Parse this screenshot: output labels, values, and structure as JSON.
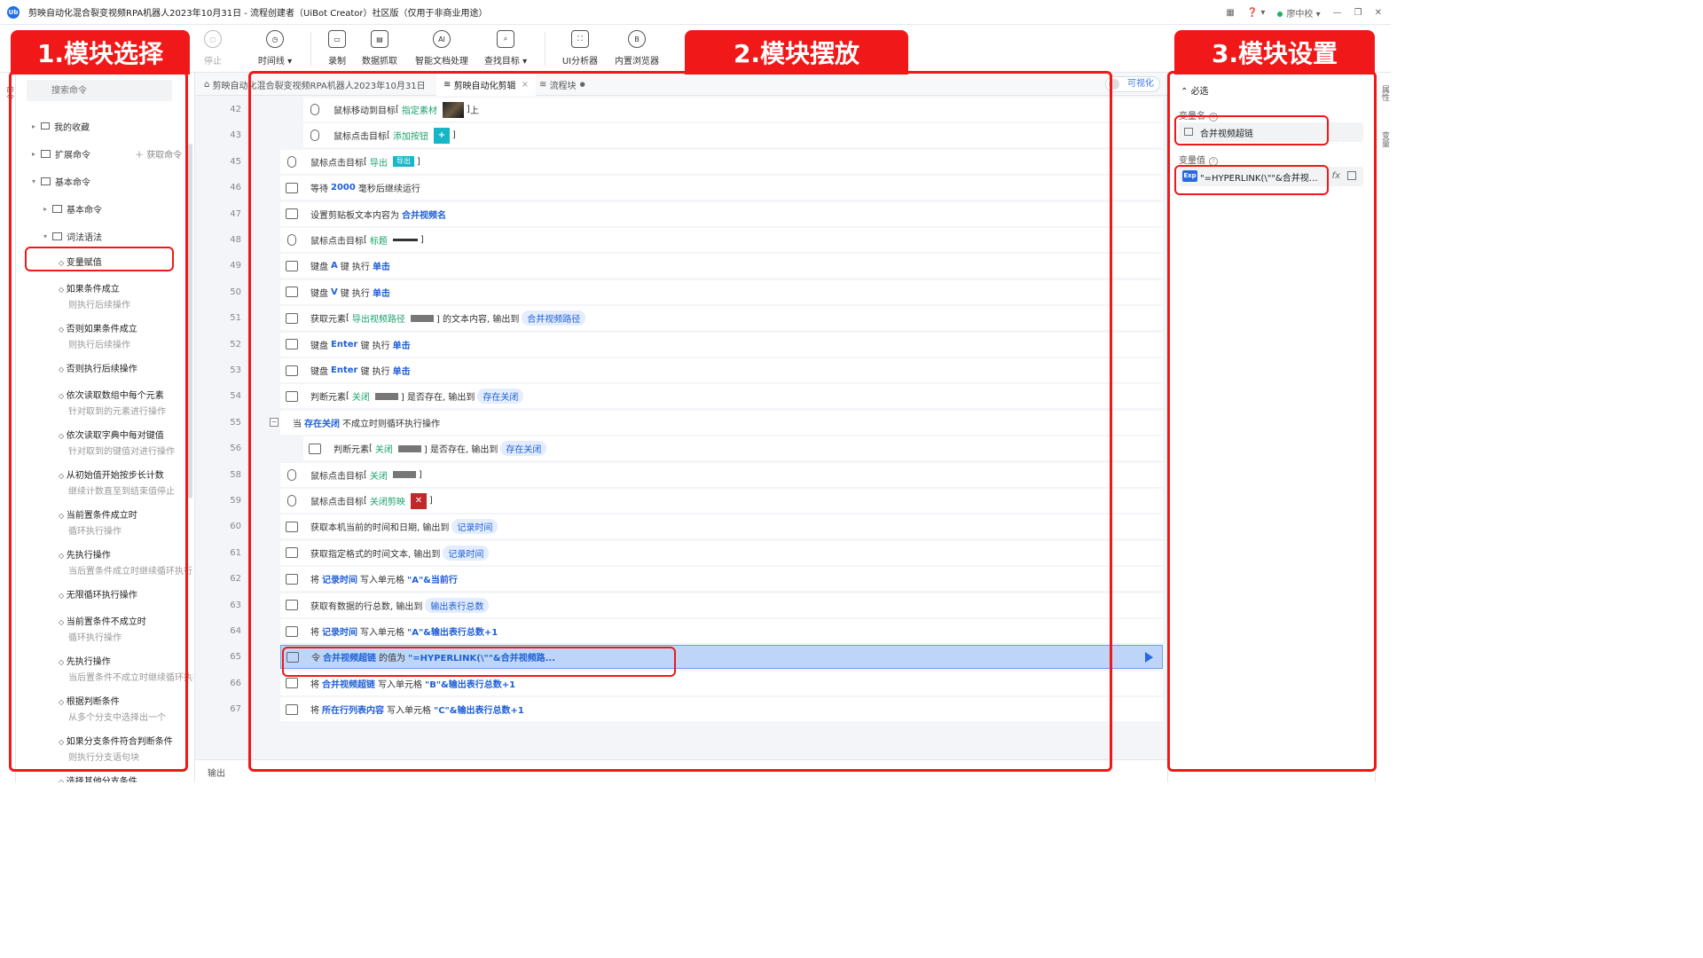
{
  "app": {
    "title": "剪映自动化混合裂变视频RPA机器人2023年10月31日 - 流程创建者（UiBot Creator）社区版（仅用于非商业用途）",
    "user": "廖中校"
  },
  "toolbar": [
    "停止",
    "时间线",
    "录制",
    "数据抓取",
    "智能文档处理",
    "查找目标",
    "UI分析器",
    "内置浏览器"
  ],
  "left_edge_label": "命令",
  "left": {
    "search_placeholder": "搜索命令",
    "fav": "我的收藏",
    "ext": "扩展命令",
    "get": "获取命令",
    "basic": "基本命令",
    "basic_sub": "基本命令",
    "syntax": "词法语法",
    "commands": [
      {
        "t": "变量赋值",
        "s": ""
      },
      {
        "t": "如果条件成立",
        "s": "则执行后续操作"
      },
      {
        "t": "否则如果条件成立",
        "s": "则执行后续操作"
      },
      {
        "t": "否则执行后续操作",
        "s": ""
      },
      {
        "t": "依次读取数组中每个元素",
        "s": "针对取到的元素进行操作"
      },
      {
        "t": "依次读取字典中每对键值",
        "s": "针对取到的键值对进行操作"
      },
      {
        "t": "从初始值开始按步长计数",
        "s": "继续计数直至到结束值停止"
      },
      {
        "t": "当前置条件成立时",
        "s": "循环执行操作"
      },
      {
        "t": "先执行操作",
        "s": "当后置条件成立时继续循环执行"
      },
      {
        "t": "无限循环执行操作",
        "s": ""
      },
      {
        "t": "当前置条件不成立时",
        "s": "循环执行操作"
      },
      {
        "t": "先执行操作",
        "s": "当后置条件不成立时继续循环执行"
      },
      {
        "t": "根据判断条件",
        "s": "从多个分支中选择出一个"
      },
      {
        "t": "如果分支条件符合判断条件",
        "s": "则执行分支语句块"
      },
      {
        "t": "选择其他分支条件",
        "s": ""
      }
    ]
  },
  "tabs": {
    "t1": "剪映自动化混合裂变视频RPA机器人2023年10月31日",
    "t2": "剪映自动化剪辑",
    "t3": "流程块",
    "toggle": "可视化"
  },
  "lines": [
    "42",
    "43",
    "45",
    "46",
    "47",
    "48",
    "49",
    "50",
    "51",
    "52",
    "53",
    "54",
    "55",
    "56",
    "58",
    "59",
    "60",
    "61",
    "62",
    "63",
    "64",
    "65",
    "66",
    "67"
  ],
  "code": {
    "r42": {
      "a": "鼠标移动到目标",
      "b": "[",
      "c": "指定素材",
      "d": "]",
      "e": "上"
    },
    "r43": {
      "a": "鼠标点击目标",
      "b": "[",
      "c": "添加按钮",
      "d": "]"
    },
    "r45": {
      "a": "鼠标点击目标",
      "b": "[",
      "c": "导出",
      "d": "]",
      "chip": "导出"
    },
    "r46": {
      "a": "等待",
      "k": "2000",
      "b": "毫秒后继续运行"
    },
    "r47": {
      "a": "设置剪贴板文本内容为",
      "k": "合并视频名"
    },
    "r48": {
      "a": "鼠标点击目标",
      "b": "[",
      "c": "标题",
      "d": "]"
    },
    "r49": {
      "a": "键盘",
      "k": "A",
      "b": "键 执行",
      "k2": "单击"
    },
    "r50": {
      "a": "键盘",
      "k": "V",
      "b": "键 执行",
      "k2": "单击"
    },
    "r51": {
      "a": "获取元素",
      "b": "[",
      "c": "导出视频路径",
      "d": "] 的文本内容, 输出到",
      "v": "合并视频路径"
    },
    "r52": {
      "a": "键盘",
      "k": "Enter",
      "b": "键 执行",
      "k2": "单击"
    },
    "r53": {
      "a": "键盘",
      "k": "Enter",
      "b": "键 执行",
      "k2": "单击"
    },
    "r54": {
      "a": "判断元素",
      "b": "[",
      "c": "关闭",
      "d": "] 是否存在, 输出到",
      "v": "存在关闭"
    },
    "r55": {
      "a": "当",
      "k": "存在关闭",
      "b": "不成立时则循环执行操作"
    },
    "r56": {
      "a": "判断元素",
      "b": "[",
      "c": "关闭",
      "d": "] 是否存在, 输出到",
      "v": "存在关闭"
    },
    "r58": {
      "a": "鼠标点击目标",
      "b": "[",
      "c": "关闭",
      "d": "]"
    },
    "r59": {
      "a": "鼠标点击目标",
      "b": "[",
      "c": "关闭剪映",
      "d": "]"
    },
    "r60": {
      "a": "获取本机当前的时间和日期, 输出到",
      "v": "记录时间"
    },
    "r61": {
      "a": "获取指定格式的时间文本, 输出到",
      "v": "记录时间"
    },
    "r62": {
      "a": "将",
      "k": "记录时间",
      "b": "写入单元格",
      "k2": "\"A\"&当前行"
    },
    "r63": {
      "a": "获取有数据的行总数, 输出到",
      "v": "输出表行总数"
    },
    "r64": {
      "a": "将",
      "k": "记录时间",
      "b": "写入单元格",
      "k2": "\"A\"&输出表行总数+1"
    },
    "r65": {
      "a": "令",
      "k": "合并视频超链",
      "b": "的值为",
      "k2": "\"=HYPERLINK(\\\"\"&合并视频路..."
    },
    "r66": {
      "a": "将",
      "k": "合并视频超链",
      "b": "写入单元格",
      "k2": "\"B\"&输出表行总数+1"
    },
    "r67": {
      "a": "将",
      "k": "所在行列表内容",
      "b": "写入单元格",
      "k2": "\"C\"&输出表行总数+1"
    }
  },
  "output_label": "输出",
  "right": {
    "section": "必选",
    "var_name_label": "变量名",
    "var_name": "合并视频超链",
    "var_value_label": "变量值",
    "exp_badge": "Exp",
    "var_value": "\"=HYPERLINK(\\\"\"&合并视频路...",
    "fx": "fx",
    "edge_top": "属性",
    "edge_bottom": "变量"
  },
  "overlays": {
    "o1": "1.模块选择",
    "o2": "2.模块摆放",
    "o3": "3.模块设置"
  },
  "colors": {
    "accent": "#1f5fd6",
    "annotation": "#f01818",
    "selected_row": "#bed5f7",
    "target_green": "#1aa36b"
  }
}
